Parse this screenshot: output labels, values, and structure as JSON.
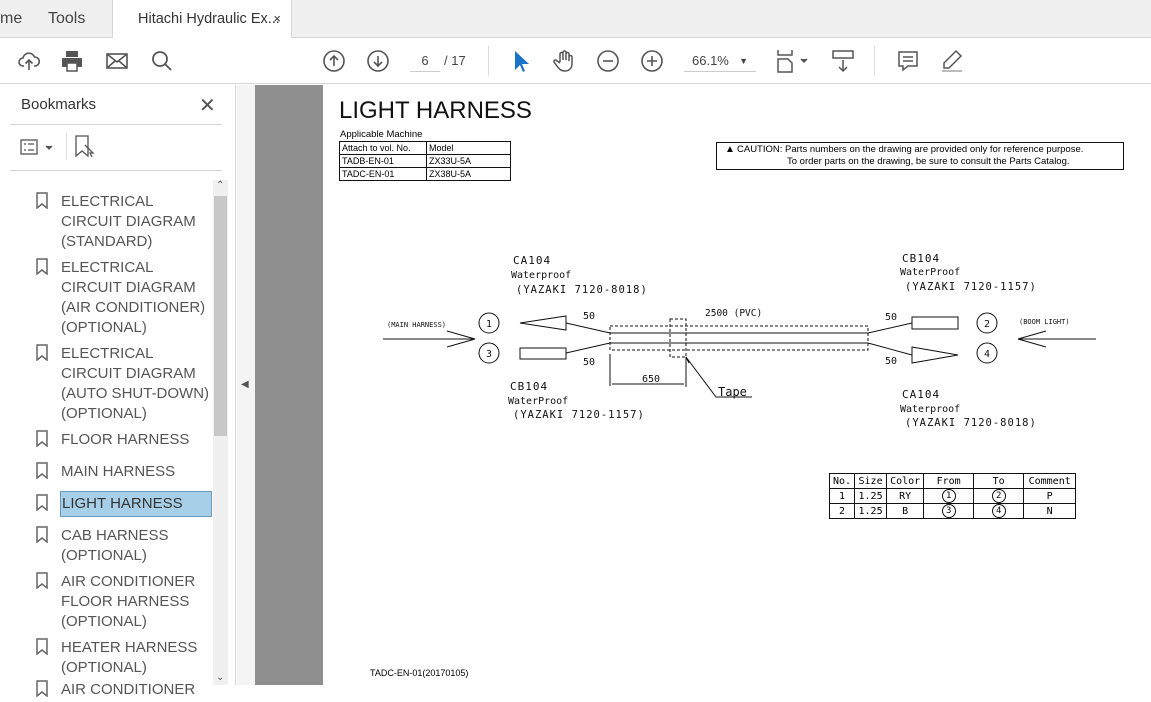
{
  "tabs": {
    "home": "me",
    "tools": "Tools",
    "document": "Hitachi Hydraulic Ex...",
    "close": "×"
  },
  "toolbar": {
    "page_current": "6",
    "page_total": "/ 17",
    "zoom": "66.1%"
  },
  "sidebar": {
    "title": "Bookmarks",
    "close": "✕",
    "items": [
      {
        "label": "ELECTRICAL CIRCUIT DIAGRAM (STANDARD)"
      },
      {
        "label": "ELECTRICAL CIRCUIT DIAGRAM  (AIR CONDITIONER) (OPTIONAL)"
      },
      {
        "label": "ELECTRICAL CIRCUIT DIAGRAM (AUTO SHUT-DOWN) (OPTIONAL)"
      },
      {
        "label": "FLOOR HARNESS"
      },
      {
        "label": "MAIN HARNESS"
      },
      {
        "label": "LIGHT HARNESS",
        "selected": true
      },
      {
        "label": "CAB HARNESS (OPTIONAL)"
      },
      {
        "label": "AIR CONDITIONER FLOOR HARNESS (OPTIONAL)"
      },
      {
        "label": "HEATER HARNESS (OPTIONAL)"
      },
      {
        "label": "AIR CONDITIONER"
      }
    ]
  },
  "doc": {
    "title": "LIGHT HARNESS",
    "applicable_caption": "Applicable Machine",
    "applicable": {
      "headers": [
        "Attach to vol. No.",
        "Model"
      ],
      "rows": [
        [
          "TADB-EN-01",
          "ZX33U-5A"
        ],
        [
          "TADC-EN-01",
          "ZX38U-5A"
        ]
      ]
    },
    "caution_line1": "CAUTION: Parts numbers on the drawing are provided only for reference purpose.",
    "caution_line2": "To order parts on the drawing, be sure to consult the Parts Catalog.",
    "diagram": {
      "tl_name": "CA104",
      "tl_type": "Waterproof",
      "tl_part": "(YAZAKI  7120-8018)",
      "tr_name": "CB104",
      "tr_type": "WaterProof",
      "tr_part": "(YAZAKI  7120-1157)",
      "bl_name": "CB104",
      "bl_type": "WaterProof",
      "bl_part": "(YAZAKI  7120-1157)",
      "br_name": "CA104",
      "br_type": "Waterproof",
      "br_part": "(YAZAKI  7120-8018)",
      "main_harness": "(MAIN HARNESS)",
      "boom_light": "(BOOM LIGHT)",
      "length": "2500 (PVC)",
      "d50": "50",
      "d650": "650",
      "tape": "Tape",
      "n1": "1",
      "n2": "2",
      "n3": "3",
      "n4": "4"
    },
    "wire_table": {
      "headers": [
        "No.",
        "Size",
        "Color",
        "From",
        "To",
        "Comment"
      ],
      "rows": [
        [
          "1",
          "1.25",
          "RY",
          "1",
          "2",
          "P"
        ],
        [
          "2",
          "1.25",
          "B",
          "3",
          "4",
          "N"
        ]
      ]
    },
    "footer": "TADC-EN-01(20170105)"
  }
}
